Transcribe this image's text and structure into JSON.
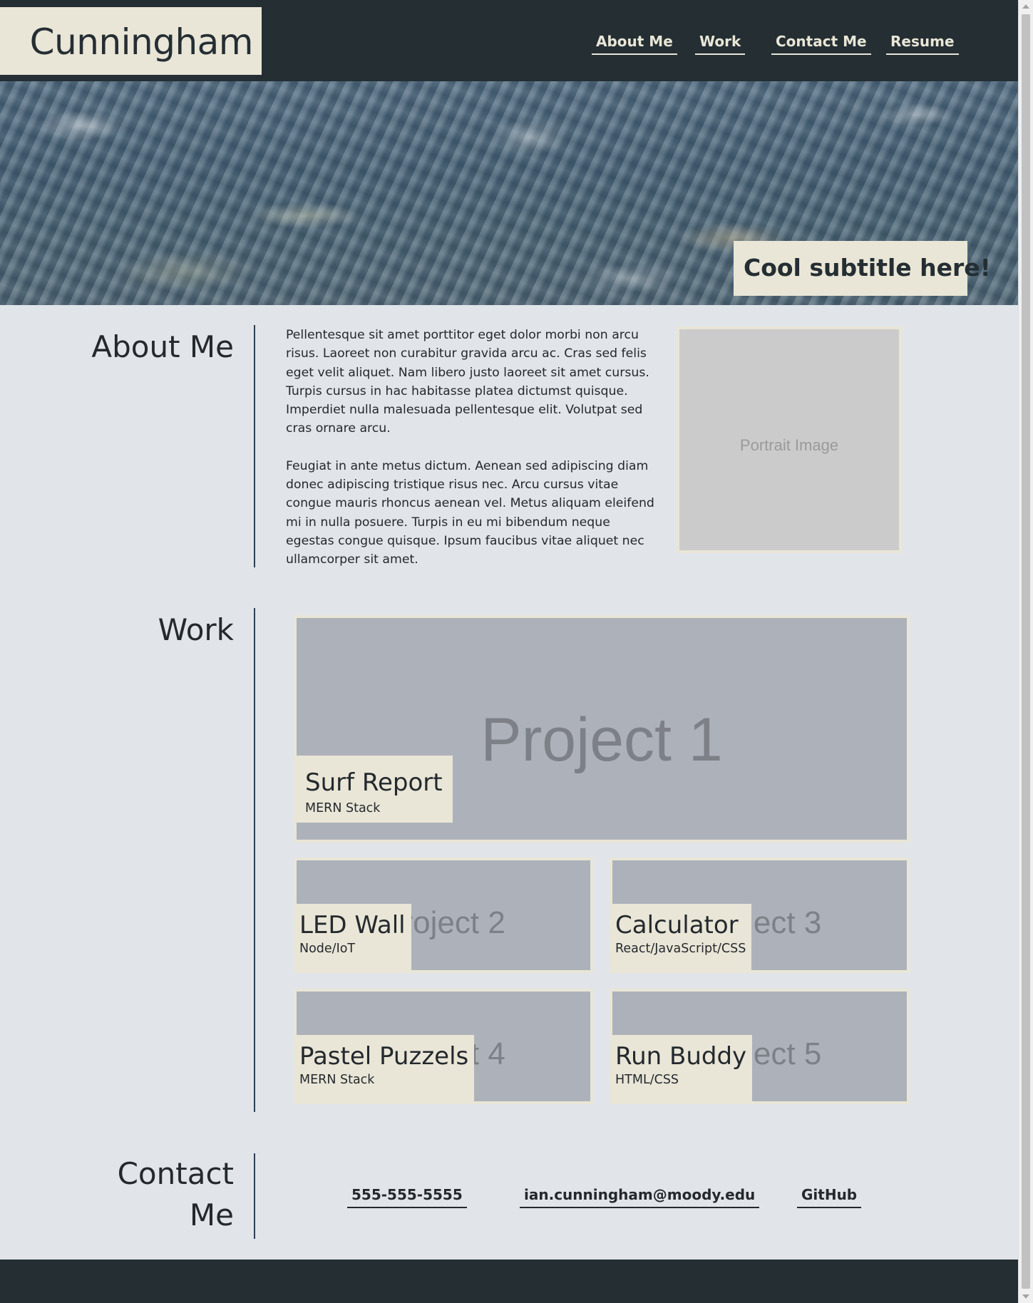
{
  "header": {
    "logo_text": "Cunningham",
    "nav": [
      {
        "label": "About Me"
      },
      {
        "label": "Work"
      },
      {
        "label": "Contact Me"
      },
      {
        "label": "Resume"
      }
    ]
  },
  "hero": {
    "subtitle": "Cool subtitle here!"
  },
  "about": {
    "title": "About Me",
    "paragraphs": [
      "Pellentesque sit amet porttitor eget dolor morbi non arcu risus. Laoreet non curabitur gravida arcu ac. Cras sed felis eget velit aliquet. Nam libero justo laoreet sit amet cursus. Turpis cursus in hac habitasse platea dictumst quisque. Imperdiet nulla malesuada pellentesque elit. Volutpat sed cras ornare arcu.",
      "Feugiat in ante metus dictum. Aenean sed adipiscing diam donec adipiscing tristique risus nec. Arcu cursus vitae congue mauris rhoncus aenean vel. Metus aliquam eleifend mi in nulla posuere. Turpis in eu mi bibendum neque egestas congue quisque. Ipsum faucibus vitae aliquet nec ullamcorper sit amet."
    ],
    "portrait_placeholder": "Portrait Image"
  },
  "work": {
    "title": "Work",
    "projects": [
      {
        "placeholder": "Project 1",
        "name": "Surf Report",
        "tech": "MERN Stack"
      },
      {
        "placeholder": "Project 2",
        "name": "LED Wall",
        "tech": "Node/IoT"
      },
      {
        "placeholder": "Project 3",
        "name": "Calculator",
        "tech": "React/JavaScript/CSS"
      },
      {
        "placeholder": "Project 4",
        "name": "Pastel Puzzels",
        "tech": "MERN Stack"
      },
      {
        "placeholder": "Project 5",
        "name": "Run Buddy",
        "tech": "HTML/CSS"
      }
    ]
  },
  "contact": {
    "title_line1": "Contact",
    "title_line2": "Me",
    "phone": "555-555-5555",
    "email": "ian.cunningham@moody.edu",
    "github": "GitHub"
  },
  "colors": {
    "header_bg": "#242e33",
    "accent_cream": "#e9e6d7",
    "page_bg": "#e1e4e9",
    "project_bg": "#adb2ba",
    "divider": "#2e3f55"
  }
}
